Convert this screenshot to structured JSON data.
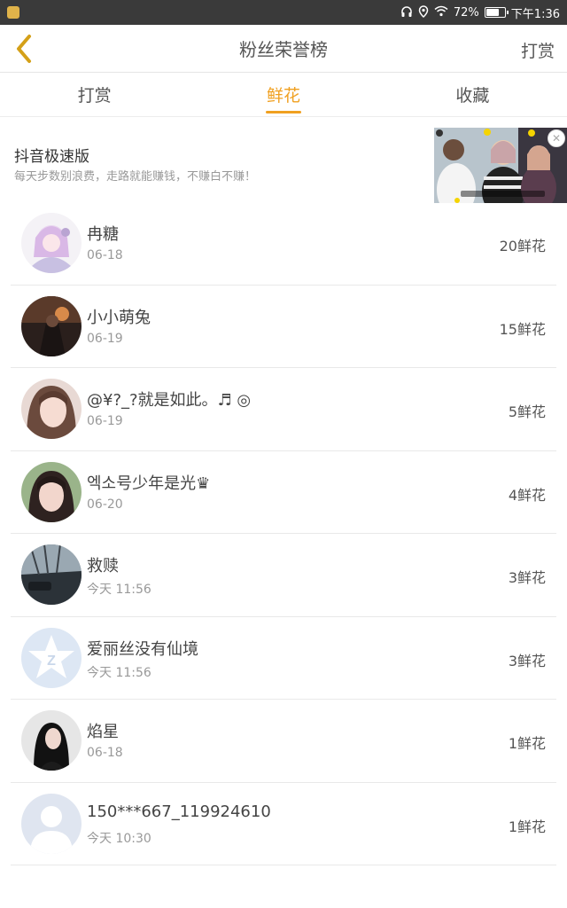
{
  "status_bar": {
    "battery": "72%",
    "battery_level": 0.72,
    "time": "下午1:36"
  },
  "header": {
    "title": "粉丝荣誉榜",
    "action": "打赏"
  },
  "tabs": [
    {
      "label": "打赏"
    },
    {
      "label": "鲜花"
    },
    {
      "label": "收藏"
    }
  ],
  "active_tab": "鲜花",
  "ad": {
    "title": "抖音极速版",
    "description": "每天步数别浪费，走路就能赚钱，不赚白不赚！",
    "close_icon": "close-icon"
  },
  "colors": {
    "accent": "#f0a020",
    "status_bar": "#3a3a3a"
  },
  "rows": [
    {
      "name": "冉糖",
      "date": "06-18",
      "amount": "20鲜花",
      "avatar": "anime-girl"
    },
    {
      "name": "小小萌兔",
      "date": "06-19",
      "amount": "15鲜花",
      "avatar": "dark-scene"
    },
    {
      "name": "@¥?_?就是如此。♬ ◎",
      "date": "06-19",
      "amount": "5鲜花",
      "avatar": "girl-portrait"
    },
    {
      "name": "엑소号少年是光♛",
      "date": "06-20",
      "amount": "4鲜花",
      "avatar": "girl-portrait-2"
    },
    {
      "name": "救赎",
      "date": "今天 11:56",
      "amount": "3鲜花",
      "avatar": "street-scene"
    },
    {
      "name": "爱丽丝没有仙境",
      "date": "今天 11:56",
      "amount": "3鲜花",
      "avatar": "qq-default-icon"
    },
    {
      "name": "焰星",
      "date": "06-18",
      "amount": "1鲜花",
      "avatar": "dark-portrait"
    },
    {
      "name": "150***667_119924610",
      "date": "今天 10:30",
      "amount": "1鲜花",
      "avatar": "default-user-icon"
    }
  ]
}
